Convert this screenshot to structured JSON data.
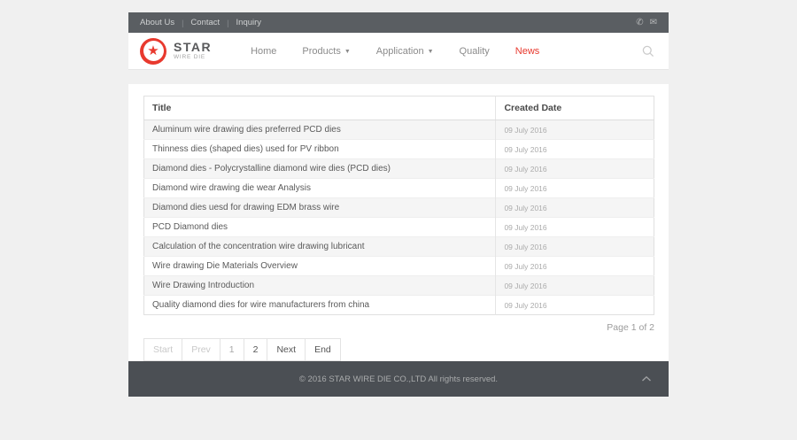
{
  "topbar": {
    "links": [
      {
        "label": "About Us"
      },
      {
        "label": "Contact"
      },
      {
        "label": "Inquiry"
      }
    ],
    "separator": "|",
    "icons": [
      {
        "name": "phone-icon",
        "glyph": "✆"
      },
      {
        "name": "mail-icon",
        "glyph": "✉"
      }
    ]
  },
  "header": {
    "logo": {
      "title": "STAR",
      "subtitle": "WIRE DIE",
      "star_glyph": "★"
    },
    "caret_glyph": "▼",
    "nav": [
      {
        "label": "Home"
      },
      {
        "label": "Products",
        "dropdown": true
      },
      {
        "label": "Application",
        "dropdown": true
      },
      {
        "label": "Quality"
      },
      {
        "label": "News",
        "active": true
      }
    ]
  },
  "table": {
    "columns": [
      "Title",
      "Created Date"
    ],
    "rows": [
      {
        "title": "Aluminum wire drawing dies preferred PCD dies",
        "date": "09 July 2016"
      },
      {
        "title": "Thinness dies (shaped dies) used for PV ribbon",
        "date": "09 July 2016"
      },
      {
        "title": "Diamond dies - Polycrystalline diamond wire dies (PCD dies)",
        "date": "09 July 2016"
      },
      {
        "title": "Diamond wire drawing die wear Analysis",
        "date": "09 July 2016"
      },
      {
        "title": "Diamond dies uesd for drawing EDM brass wire",
        "date": "09 July 2016"
      },
      {
        "title": "PCD Diamond dies",
        "date": "09 July 2016"
      },
      {
        "title": "Calculation of the concentration wire drawing lubricant",
        "date": "09 July 2016"
      },
      {
        "title": "Wire drawing Die Materials Overview",
        "date": "09 July 2016"
      },
      {
        "title": "Wire Drawing Introduction",
        "date": "09 July 2016"
      },
      {
        "title": "Quality diamond dies for wire manufacturers from china",
        "date": "09 July 2016"
      }
    ]
  },
  "pagination": {
    "page_info": "Page 1 of 2",
    "buttons": [
      {
        "label": "Start",
        "state": "disabled"
      },
      {
        "label": "Prev",
        "state": "disabled"
      },
      {
        "label": "1",
        "state": "current"
      },
      {
        "label": "2",
        "state": "link"
      },
      {
        "label": "Next",
        "state": "link"
      },
      {
        "label": "End",
        "state": "link"
      }
    ]
  },
  "footer": {
    "copyright": "© 2016 STAR WIRE DIE CO.,LTD All rights reserved."
  },
  "colors": {
    "accent_red": "#e8392e",
    "topbar_bg": "#5a5e62",
    "footer_bg": "#4b4f54",
    "stripe": "#f5f5f5",
    "page_bg": "#f0f0f0"
  }
}
